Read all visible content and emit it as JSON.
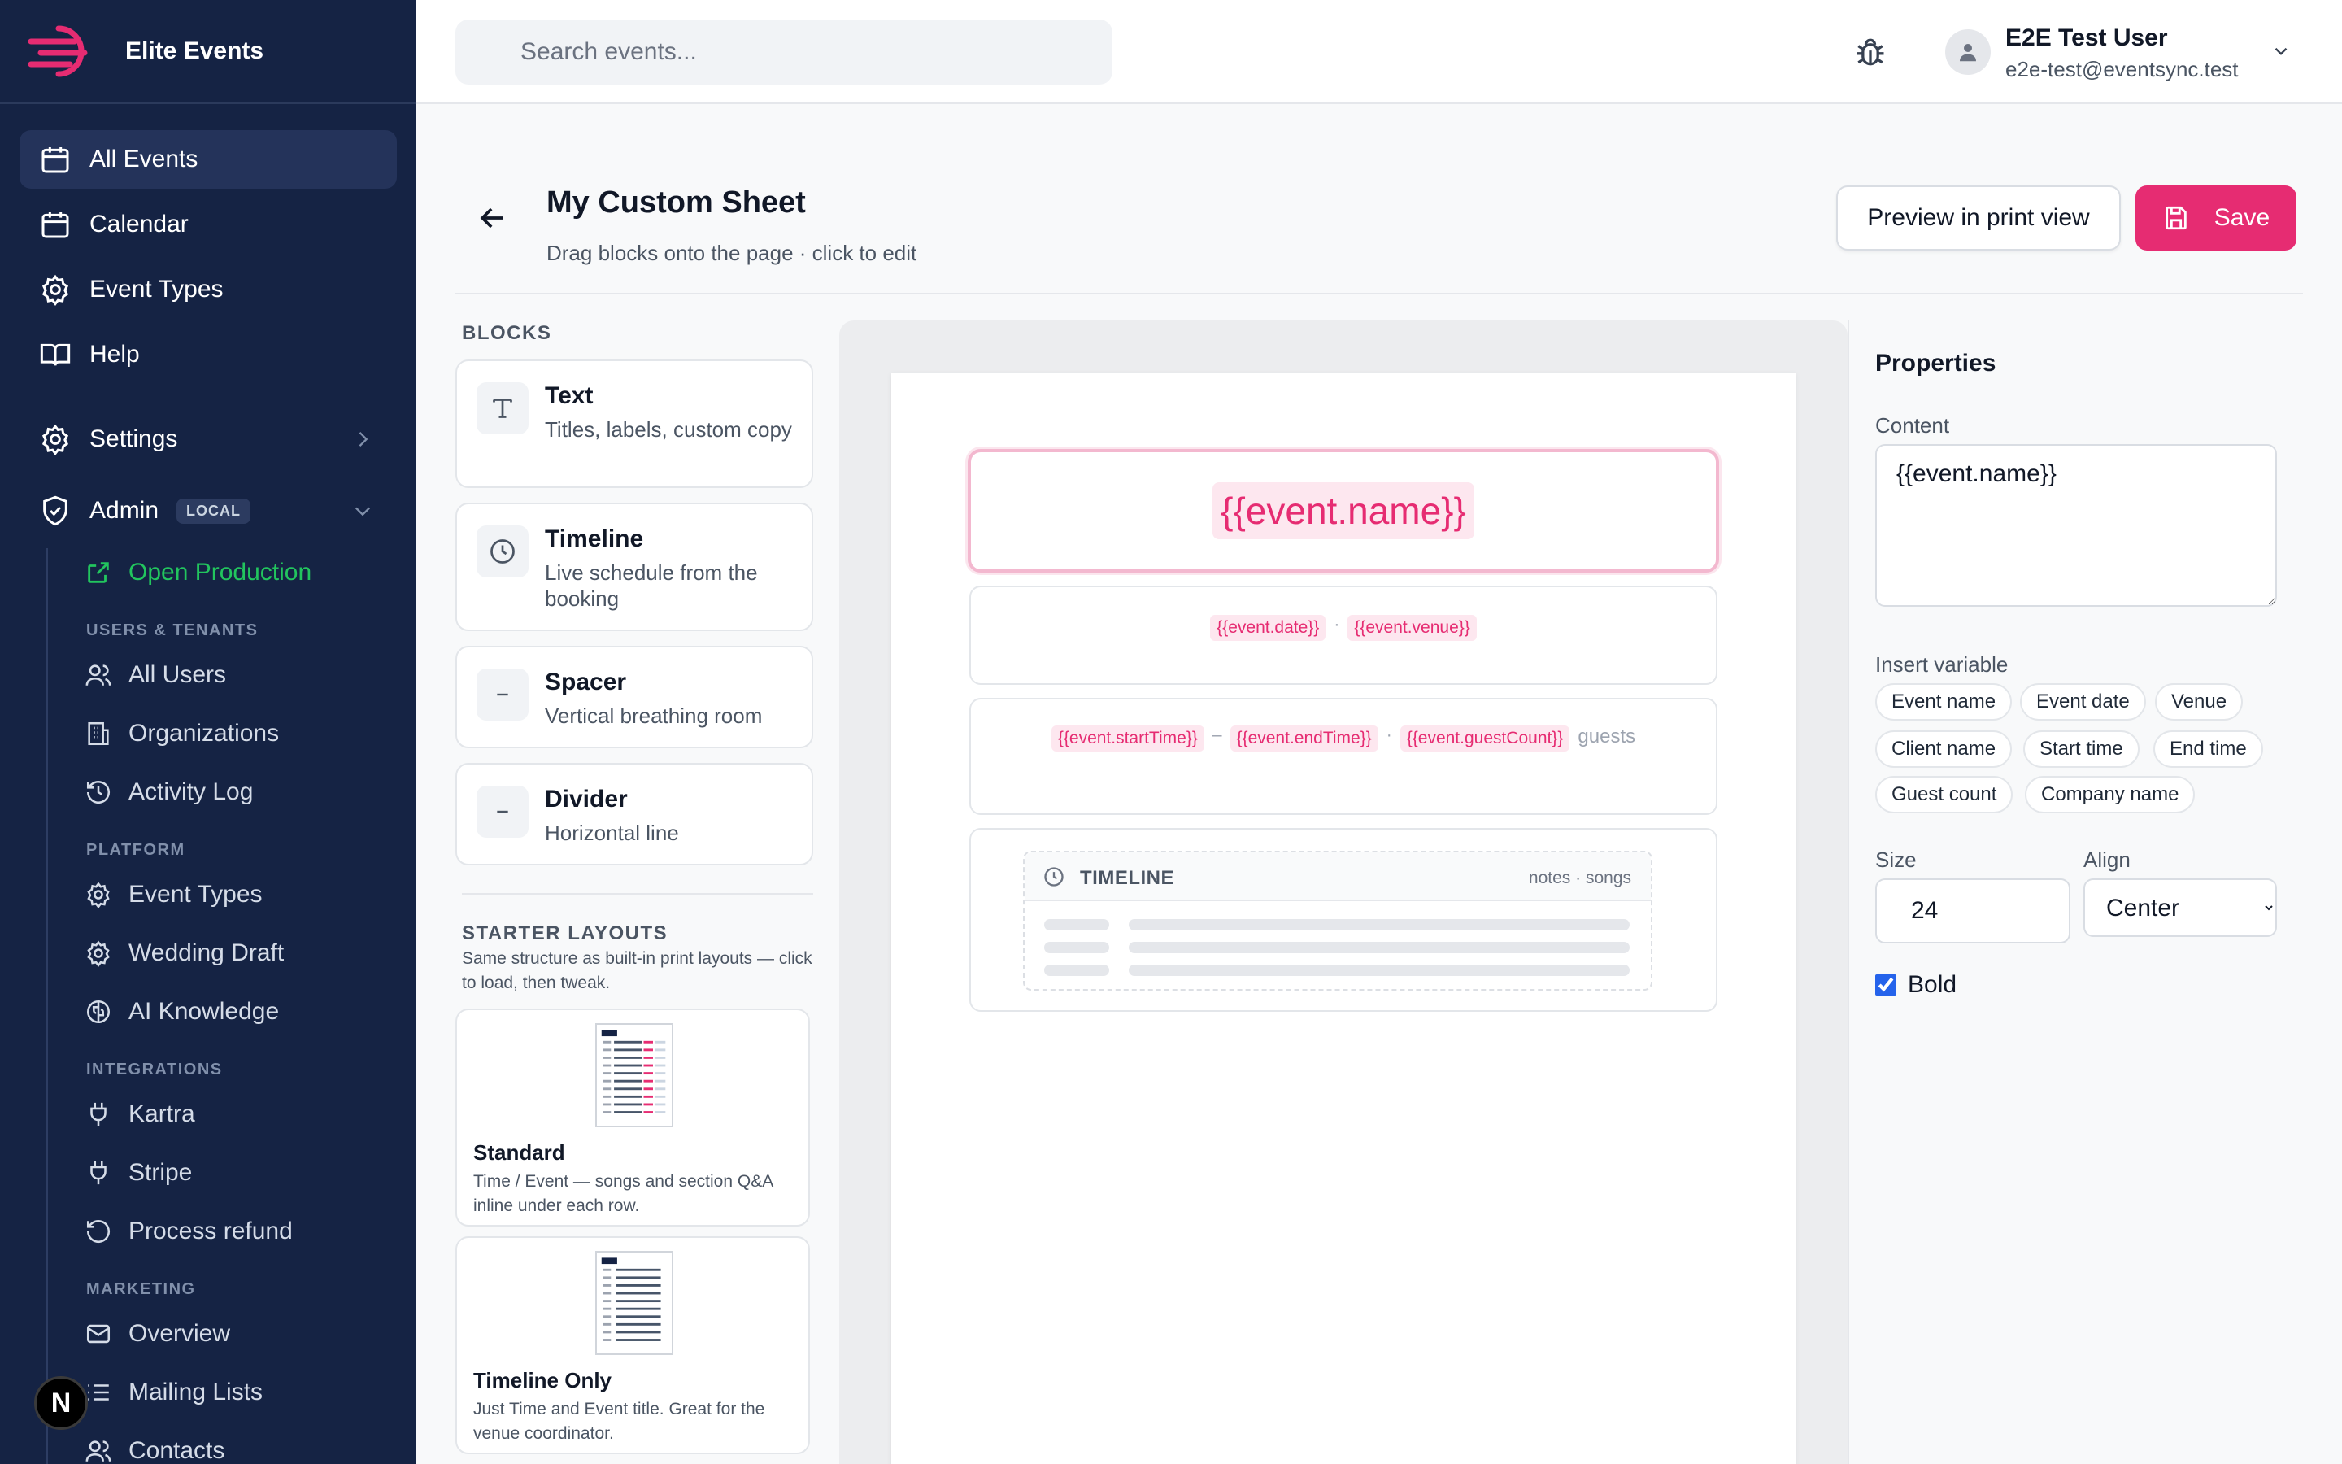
{
  "app": {
    "name": "Elite Events"
  },
  "sidebar": {
    "nav": [
      {
        "label": "All Events",
        "icon": "calendar-icon",
        "active": true
      },
      {
        "label": "Calendar",
        "icon": "calendar-icon"
      },
      {
        "label": "Event Types",
        "icon": "gear-icon"
      },
      {
        "label": "Help",
        "icon": "book-icon"
      },
      {
        "label": "Settings",
        "icon": "gear-icon"
      },
      {
        "label": "Admin",
        "icon": "shield-icon",
        "badge": "LOCAL"
      }
    ],
    "open_production": "Open Production",
    "sections": [
      {
        "heading": "USERS & TENANTS",
        "items": [
          "All Users",
          "Organizations",
          "Activity Log"
        ]
      },
      {
        "heading": "PLATFORM",
        "items": [
          "Event Types",
          "Wedding Draft",
          "AI Knowledge"
        ]
      },
      {
        "heading": "INTEGRATIONS",
        "items": [
          "Kartra",
          "Stripe",
          "Process refund"
        ]
      },
      {
        "heading": "MARKETING",
        "items": [
          "Overview",
          "Mailing Lists",
          "Contacts"
        ]
      }
    ],
    "next_badge": "N"
  },
  "topbar": {
    "search_placeholder": "Search events...",
    "user_name": "E2E Test User",
    "user_email": "e2e-test@eventsync.test"
  },
  "header": {
    "title": "My Custom Sheet",
    "subtitle": "Drag blocks onto the page · click to edit",
    "preview_label": "Preview in print view",
    "save_label": "Save"
  },
  "blocks_panel": {
    "heading": "BLOCKS",
    "blocks": [
      {
        "title": "Text",
        "desc": "Titles, labels, custom copy",
        "icon": "text-icon"
      },
      {
        "title": "Timeline",
        "desc": "Live schedule from the booking",
        "icon": "clock-icon"
      },
      {
        "title": "Spacer",
        "desc": "Vertical breathing room",
        "icon": "minus-icon"
      },
      {
        "title": "Divider",
        "desc": "Horizontal line",
        "icon": "minus-icon"
      }
    ],
    "layouts_heading": "STARTER LAYOUTS",
    "layouts_desc": "Same structure as built-in print layouts — click to load, then tweak.",
    "layouts": [
      {
        "title": "Standard",
        "desc": "Time / Event — songs and section Q&A inline under each row."
      },
      {
        "title": "Timeline Only",
        "desc": "Just Time and Event title. Great for the venue coordinator."
      }
    ]
  },
  "canvas": {
    "name_var": "{{event.name}}",
    "date_var": "{{event.date}}",
    "venue_var": "{{event.venue}}",
    "sep_dot": "·",
    "start_var": "{{event.startTime}}",
    "dash": "–",
    "end_var": "{{event.endTime}}",
    "guest_var": "{{event.guestCount}}",
    "guests_label": "guests",
    "timeline_label": "TIMELINE",
    "timeline_meta": "notes · songs"
  },
  "properties": {
    "title": "Properties",
    "content_label": "Content",
    "content_value": "{{event.name}}",
    "insert_label": "Insert variable",
    "variables": [
      "Event name",
      "Event date",
      "Venue",
      "Client name",
      "Start time",
      "End time",
      "Guest count",
      "Company name"
    ],
    "size_label": "Size",
    "size_value": "24",
    "align_label": "Align",
    "align_value": "Center",
    "bold_label": "Bold",
    "bold_checked": true
  },
  "colors": {
    "accent": "#e62c72",
    "sidebar_bg": "#152344",
    "success": "#22c55e"
  }
}
